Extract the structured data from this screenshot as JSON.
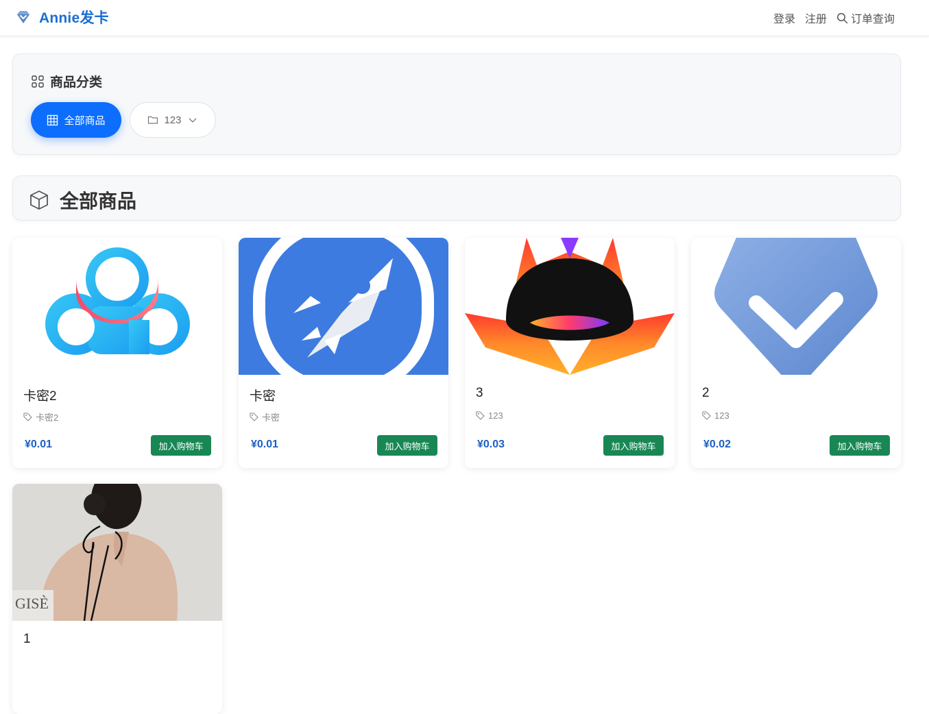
{
  "navbar": {
    "brand": "Annie发卡",
    "brand_icon": "diamond-icon",
    "links": {
      "login": "登录",
      "register": "注册",
      "order_query": "订单查询"
    }
  },
  "categories": {
    "title": "商品分类",
    "title_icon": "grid-icon",
    "all_button": "全部商品",
    "category_button": "123"
  },
  "section": {
    "title": "全部商品",
    "icon": "box-icon"
  },
  "products": [
    {
      "name": "卡密2",
      "tag": "卡密2",
      "price": "¥0.01",
      "cart": "加入购物车",
      "image": "cloud-logo"
    },
    {
      "name": "卡密",
      "tag": "卡密",
      "price": "¥0.01",
      "cart": "加入购物车",
      "image": "rocket-logo"
    },
    {
      "name": "3",
      "tag": "123",
      "price": "¥0.03",
      "cart": "加入购物车",
      "image": "flame-mask-logo"
    },
    {
      "name": "2",
      "tag": "123",
      "price": "¥0.02",
      "cart": "加入购物车",
      "image": "check-badge-logo"
    },
    {
      "name": "1",
      "image": "photo-woman-back",
      "watermark": "GISÈ"
    }
  ],
  "colors": {
    "primary": "#0d6efd",
    "success": "#198754",
    "brand": "#1a6fd0",
    "price": "#1a5fc4"
  }
}
